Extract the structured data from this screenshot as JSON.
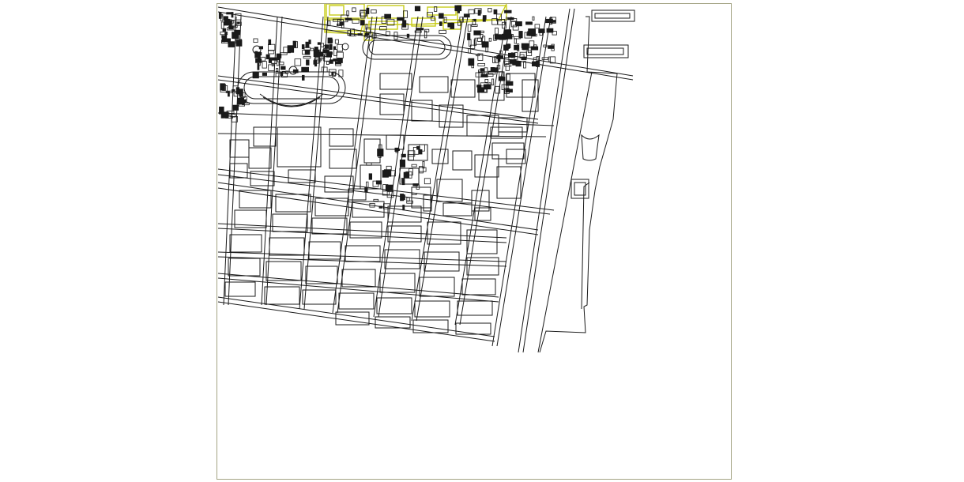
{
  "drawing": {
    "sheet_border_color": "#a3a383",
    "linework_color": "#1a1a1a",
    "highlight_color": "#c8cc1a",
    "background_color": "#ffffff"
  }
}
